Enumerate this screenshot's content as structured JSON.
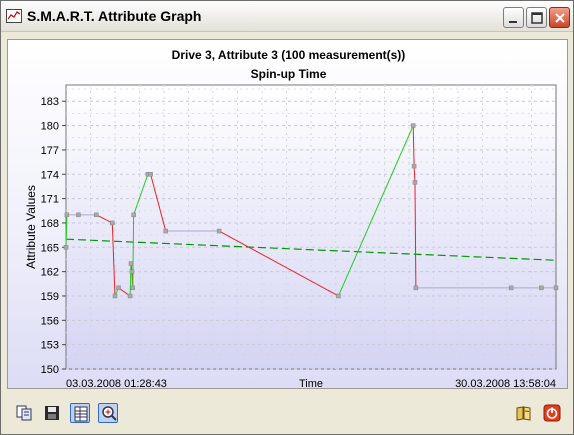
{
  "window": {
    "title": "S.M.A.R.T. Attribute Graph"
  },
  "chart": {
    "title_line1": "Drive 3, Attribute   3 (100 measurement(s))",
    "title_line2": "Spin-up Time"
  },
  "chart_data": {
    "type": "line",
    "title": "Drive 3, Attribute   3 (100 measurement(s))",
    "subtitle": "Spin-up Time",
    "xlabel": "Time",
    "ylabel": "Attribute Values",
    "x_start_label": "03.03.2008 01:28:43",
    "x_end_label": "30.03.2008 13:58:04",
    "ylim": [
      150,
      185
    ],
    "yticks": [
      150,
      153,
      156,
      159,
      162,
      165,
      168,
      171,
      174,
      177,
      180,
      183
    ],
    "xlim": [
      0,
      27.52
    ],
    "grid": true,
    "series": [
      {
        "color_up": "#22cc22",
        "color_down": "#ee2222",
        "points": [
          [
            0.0,
            165
          ],
          [
            0.05,
            169
          ],
          [
            0.7,
            169
          ],
          [
            1.7,
            169
          ],
          [
            2.6,
            168
          ],
          [
            2.75,
            159
          ],
          [
            2.95,
            160
          ],
          [
            3.6,
            159
          ],
          [
            3.65,
            163
          ],
          [
            3.7,
            162
          ],
          [
            3.75,
            160
          ],
          [
            3.8,
            169
          ],
          [
            4.6,
            174
          ],
          [
            4.75,
            174
          ],
          [
            5.6,
            167
          ],
          [
            8.6,
            167
          ],
          [
            15.3,
            159
          ],
          [
            19.5,
            180
          ],
          [
            19.55,
            175
          ],
          [
            19.6,
            173
          ],
          [
            19.65,
            160
          ],
          [
            25.0,
            160
          ],
          [
            26.7,
            160
          ],
          [
            27.52,
            160
          ]
        ]
      }
    ],
    "trend": {
      "color": "#009900",
      "start": 166,
      "end": 163.4
    }
  },
  "toolbar": {
    "copy_icon": "copy-icon",
    "save_icon": "save-icon",
    "table_icon": "table-icon",
    "zoom_icon": "zoom-icon",
    "help_icon": "help-book-icon",
    "close_icon": "power-icon"
  }
}
